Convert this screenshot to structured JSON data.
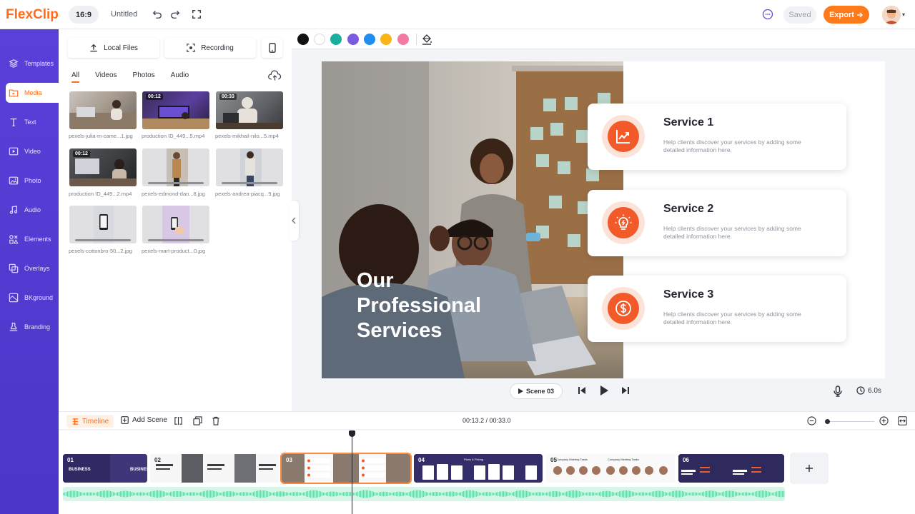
{
  "app": {
    "brand": "FlexClip",
    "ratio": "16:9",
    "doc_title": "Untitled",
    "saved_label": "Saved",
    "export_label": "Export"
  },
  "nav": [
    {
      "id": "templates",
      "label": "Templates",
      "icon": "layers-icon"
    },
    {
      "id": "media",
      "label": "Media",
      "icon": "media-folder-icon",
      "active": true
    },
    {
      "id": "text",
      "label": "Text",
      "icon": "text-icon"
    },
    {
      "id": "video",
      "label": "Video",
      "icon": "video-icon"
    },
    {
      "id": "photo",
      "label": "Photo",
      "icon": "photo-icon"
    },
    {
      "id": "audio",
      "label": "Audio",
      "icon": "music-icon"
    },
    {
      "id": "elements",
      "label": "Elements",
      "icon": "elements-icon"
    },
    {
      "id": "overlays",
      "label": "Overlays",
      "icon": "overlays-icon"
    },
    {
      "id": "bkground",
      "label": "BKground",
      "icon": "background-icon"
    },
    {
      "id": "branding",
      "label": "Branding",
      "icon": "stamp-icon"
    }
  ],
  "media": {
    "local_files_label": "Local Files",
    "recording_label": "Recording",
    "tabs": [
      "All",
      "Videos",
      "Photos",
      "Audio"
    ],
    "items": [
      {
        "label": "pexels-julia-m-came...1.jpg",
        "duration": ""
      },
      {
        "label": "production ID_449...5.mp4",
        "duration": "00:12"
      },
      {
        "label": "pexels-mikhail-nilo...5.mp4",
        "duration": "00:33"
      },
      {
        "label": "production ID_449...2.mp4",
        "duration": "00:12"
      },
      {
        "label": "pexels-edmond-dan...8.jpg",
        "duration": ""
      },
      {
        "label": "pexels-andrea-piacq...9.jpg",
        "duration": ""
      },
      {
        "label": "pexels-cottonbro-50...2.jpg",
        "duration": ""
      },
      {
        "label": "pexels-mart-product...0.jpg",
        "duration": ""
      }
    ]
  },
  "colors": {
    "swatches": [
      "#111111",
      "#ffffff",
      "#1aae9f",
      "#7b5ce0",
      "#1f8ef1",
      "#f9b515",
      "#f27aa4"
    ],
    "accent": "#ff6b1a",
    "nav_bg": "#5b3fd9"
  },
  "canvas": {
    "headline": [
      "Our",
      "Professional",
      "Services"
    ],
    "services": [
      {
        "title": "Service 1",
        "desc": "Help clients discover your services by adding some detailed information here.",
        "icon": "chart-icon"
      },
      {
        "title": "Service 2",
        "desc": "Help clients discover your services by adding some detailed information here.",
        "icon": "lightbulb-icon"
      },
      {
        "title": "Service 3",
        "desc": "Help clients discover your services by adding some detailed information here.",
        "icon": "dollar-icon"
      }
    ]
  },
  "player": {
    "scene_label": "Scene 03",
    "duration": "6.0s"
  },
  "timeline": {
    "label": "Timeline",
    "add_scene_label": "Add Scene",
    "timecode": "00:13.2 / 00:33.0",
    "scenes": [
      {
        "num": "01",
        "text": "BUSINESS"
      },
      {
        "num": "02",
        "text": ""
      },
      {
        "num": "03",
        "text": ""
      },
      {
        "num": "04",
        "text": "Plans & Pricing"
      },
      {
        "num": "05",
        "text": "Company Meeting Tasks"
      },
      {
        "num": "06",
        "text": ""
      }
    ]
  }
}
